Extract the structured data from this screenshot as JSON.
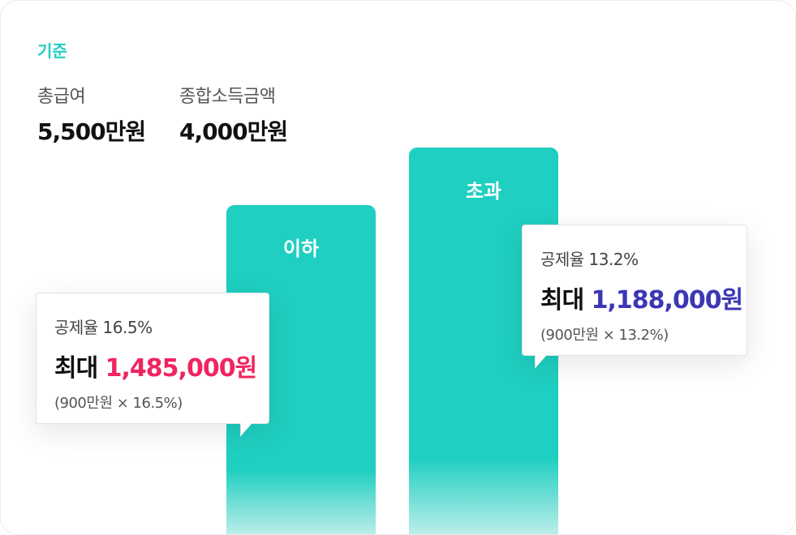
{
  "header": {
    "criteria_title": "기준",
    "stats": [
      {
        "label": "총급여",
        "value": "5,500만원"
      },
      {
        "label": "종합소득금액",
        "value": "4,000만원"
      }
    ]
  },
  "chart_data": {
    "type": "bar",
    "categories": [
      "이하",
      "초과"
    ],
    "series": [
      {
        "values": [
          16.5,
          13.2
        ]
      }
    ],
    "bar_color": "#1fcfc1"
  },
  "tooltips": [
    {
      "rate_text": "공제율 16.5%",
      "max_prefix": "최대",
      "amount": "1,485,000원",
      "formula": "(900만원 × 16.5%)",
      "amount_color": "#f0255f"
    },
    {
      "rate_text": "공제율 13.2%",
      "max_prefix": "최대",
      "amount": "1,188,000원",
      "formula": "(900만원 × 13.2%)",
      "amount_color": "#3c37b5"
    }
  ]
}
